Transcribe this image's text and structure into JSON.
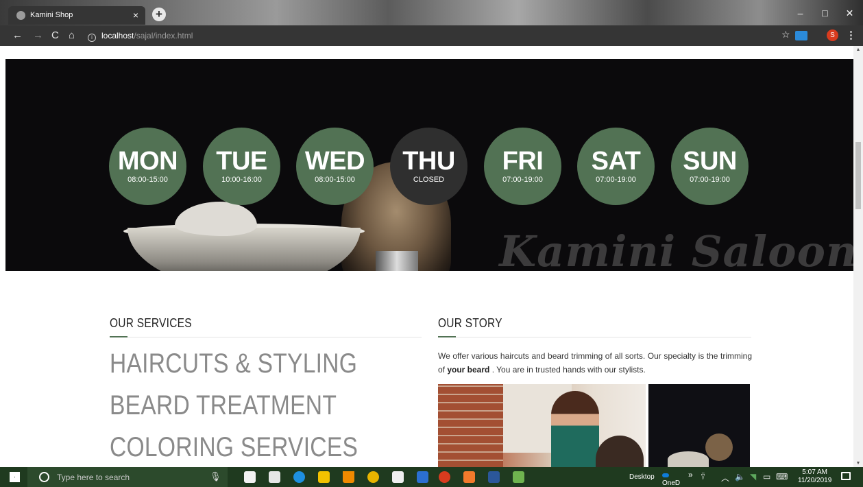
{
  "browser": {
    "tab_title": "Kamini Shop",
    "tab_close": "×",
    "new_tab": "+",
    "window_buttons": {
      "minimize": "–",
      "maximize": "□",
      "close": "✕"
    },
    "nav": {
      "back": "←",
      "forward": "→",
      "reload": "C",
      "home": "⌂"
    },
    "address": {
      "host": "localhost",
      "path": "/sajal/index.html"
    },
    "profile_initial": "S",
    "star": "☆",
    "menu": "⋮"
  },
  "hero": {
    "watermark": "Kamini Saloon",
    "days": [
      {
        "name": "MON",
        "hours": "08:00-15:00",
        "closed": false
      },
      {
        "name": "TUE",
        "hours": "10:00-16:00",
        "closed": false
      },
      {
        "name": "WED",
        "hours": "08:00-15:00",
        "closed": false
      },
      {
        "name": "THU",
        "hours": "CLOSED",
        "closed": true
      },
      {
        "name": "FRI",
        "hours": "07:00-19:00",
        "closed": false
      },
      {
        "name": "SAT",
        "hours": "07:00-19:00",
        "closed": false
      },
      {
        "name": "SUN",
        "hours": "07:00-19:00",
        "closed": false
      }
    ]
  },
  "services": {
    "title": "OUR SERVICES",
    "items": [
      "HAIRCUTS & STYLING",
      "BEARD TREATMENT",
      "COLORING SERVICES"
    ]
  },
  "story": {
    "title": "OUR STORY",
    "text_before": "We offer various haircuts and beard trimming of all sorts. Our specialty is the trimming of ",
    "text_bold": "your beard",
    "text_after": " . You are in trusted hands with our stylists."
  },
  "taskbar": {
    "search_placeholder": "Type here to search",
    "desktop_label": "Desktop",
    "onedrive_label": "OneD",
    "overflow": "»",
    "time": "5:07 AM",
    "date": "11/20/2019"
  },
  "colors": {
    "accent": "#527254",
    "closed": "#2f2f2f",
    "taskbar": "#1f3a1f"
  }
}
